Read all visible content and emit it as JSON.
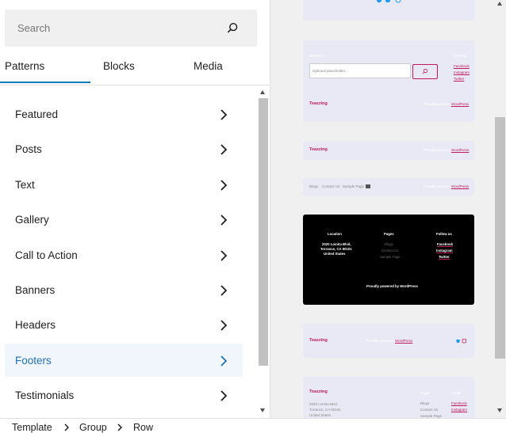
{
  "search": {
    "placeholder": "Search"
  },
  "tabs": [
    {
      "label": "Patterns"
    },
    {
      "label": "Blocks"
    },
    {
      "label": "Media"
    }
  ],
  "categories": [
    {
      "label": "Featured"
    },
    {
      "label": "Posts"
    },
    {
      "label": "Text"
    },
    {
      "label": "Gallery"
    },
    {
      "label": "Call to Action"
    },
    {
      "label": "Banners"
    },
    {
      "label": "Headers"
    },
    {
      "label": "Footers"
    },
    {
      "label": "Testimonials"
    }
  ],
  "preview": {
    "search_card": {
      "heading": "SEARCH",
      "input_placeholder": "Optional placeholder...",
      "social_heading": "SOCIAL",
      "links": [
        "Facebook",
        "Instagram",
        "Twitter"
      ],
      "brand": "Teazzing",
      "powered": "Proudly powered by",
      "wp": "WordPress"
    },
    "simple_card": {
      "brand": "Teazzing",
      "powered": "Proudly powered by",
      "wp": "WordPress"
    },
    "nav_card": {
      "links": [
        "Blogs",
        "Contact Us",
        "Sample Page"
      ],
      "powered": "Proudly powered by",
      "wp": "WordPress"
    },
    "dark_card": {
      "location_heading": "Location",
      "address": [
        "2020 Lomita Blvd,",
        "Torrance, CA 90101",
        "United States"
      ],
      "pages_heading": "Pages",
      "pages": [
        "Blogs",
        "Contact Us",
        "Sample Page"
      ],
      "follow_heading": "Follow us",
      "follow": [
        "Facebook",
        "Instagram",
        "Twitter"
      ],
      "powered": "Proudly powered by WordPress"
    },
    "social_card": {
      "brand": "Teazzing",
      "powered": "Proudly powered by",
      "wp": "WordPress"
    },
    "full_card": {
      "brand": "Teazzing",
      "address": [
        "2020 Lomita Blvd,",
        "Torrance, CA 90101",
        "United States"
      ],
      "pages_heading": "Pages",
      "pages": [
        "Blogs",
        "Contact Us",
        "Sample Page"
      ],
      "social_heading": "Social",
      "social": [
        "Facebook",
        "Instagram"
      ]
    }
  },
  "breadcrumbs": [
    {
      "label": "Template"
    },
    {
      "label": "Group"
    },
    {
      "label": "Row"
    }
  ],
  "colors": {
    "accent": "#007cba",
    "active_text": "#2271b1",
    "brand_pink": "#c2185b",
    "social_blue": "#1d9bf0"
  },
  "icons": {
    "search": "search-icon",
    "chevron": "chevron-right-icon",
    "twitter": "twitter-icon",
    "instagram": "instagram-icon"
  }
}
